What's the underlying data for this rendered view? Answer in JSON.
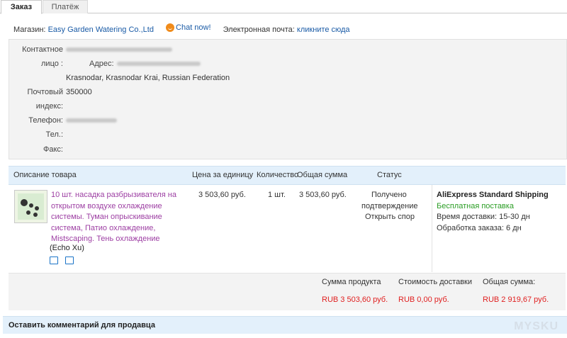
{
  "tabs": [
    {
      "label": "Заказ"
    },
    {
      "label": "Платёж"
    }
  ],
  "shop": {
    "label": "Магазин:",
    "name": "Easy Garden Watering Co.,Ltd",
    "chat": "Chat now!",
    "email_label": "Электронная почта:",
    "email_link": "кликните сюда"
  },
  "address": {
    "contact_label_1": "Контактное",
    "contact_label_2": "лицо :",
    "addr_label": "Адрес:",
    "city": "Krasnodar, Krasnodar Krai, Russian Federation",
    "zip_label_1": "Почтовый",
    "zip_label_2": "индекс:",
    "zip": "350000",
    "phone_label": "Телефон:",
    "tel_label": "Тел.:",
    "fax_label": "Факс:"
  },
  "table": {
    "headers": [
      "Описание товара",
      "Цена за единицу",
      "Количество",
      "Общая сумма",
      "Статус"
    ]
  },
  "item": {
    "title_lines": [
      "10 шт. насадка разбрызивателя на",
      "открытом воздухе охлаждение",
      "системы. Туман опрыскивание",
      "система, Патио охлаждение,",
      "Mistscaping. Тень охлаждение"
    ],
    "seller": "(Echo Xu)",
    "price": "3 503,60 руб.",
    "qty": "1 шт.",
    "total": "3 503,60 руб.",
    "status_1": "Получено",
    "status_2": "подтверждение",
    "dispute": "Открыть спор"
  },
  "shipping": {
    "method": "AliExpress Standard Shipping",
    "free": "Бесплатная поставка",
    "delivery": "Время доставки: 15-30 дн",
    "processing": "Обработка заказа: 6 дн"
  },
  "totals": {
    "product_label": "Сумма продукта",
    "shipping_label": "Стоимость доставки",
    "total_label": "Общая сумма:",
    "product": "RUB 3 503,60 руб.",
    "shipping": "RUB 0,00 руб.",
    "total": "RUB 2 919,67 руб."
  },
  "comment": {
    "label": "Оставить комментарий для продавца"
  },
  "watermark": "MYSKU",
  "colors": {
    "link": "#1a5ba6",
    "product": "#9d3fa3",
    "price_red": "#e02020",
    "free_green": "#2a9d24",
    "header_bg": "#e3f0fb"
  }
}
